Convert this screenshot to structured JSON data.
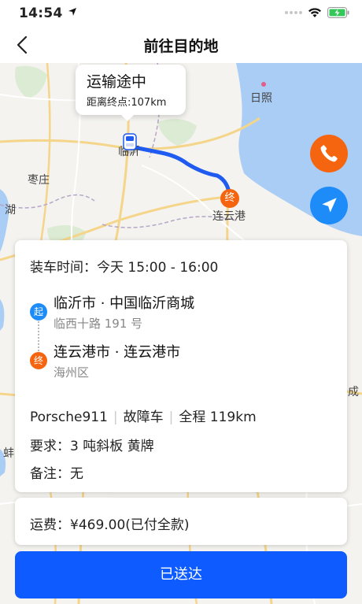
{
  "status_bar": {
    "time": "14:54"
  },
  "nav": {
    "title": "前往目的地"
  },
  "map": {
    "bubble_title": "运输途中",
    "bubble_distance": "距离终点:107km",
    "labels": {
      "rizhao": "日照",
      "zaozhuang": "枣庄",
      "lianyungang": "连云港",
      "linyi": "临沂",
      "hu": "湖",
      "cheng": "成",
      "bang": "蚌"
    },
    "end_marker_text": "终",
    "colors": {
      "water": "#a9cdf5",
      "route": "#1f5bf0",
      "accent_orange": "#f5650f",
      "accent_blue": "#1d8cf8"
    }
  },
  "order": {
    "loading_time": "装车时间：今天 15:00 - 16:00",
    "start_badge": "起",
    "start_title": "临沂市 · 中国临沂商城",
    "start_detail": "临西十路 191 号",
    "end_badge": "终",
    "end_title": "连云港市 · 连云港市",
    "end_detail": "海州区",
    "vehicle": "Porsche911",
    "vehicle_status": "故障车",
    "total_distance": "全程 119km",
    "requirement": "要求：3 吨斜板 黄牌",
    "note": "备注：无"
  },
  "fee": {
    "text": "运费：¥469.00(已付全款)"
  },
  "action": {
    "submit_label": "已送达"
  }
}
